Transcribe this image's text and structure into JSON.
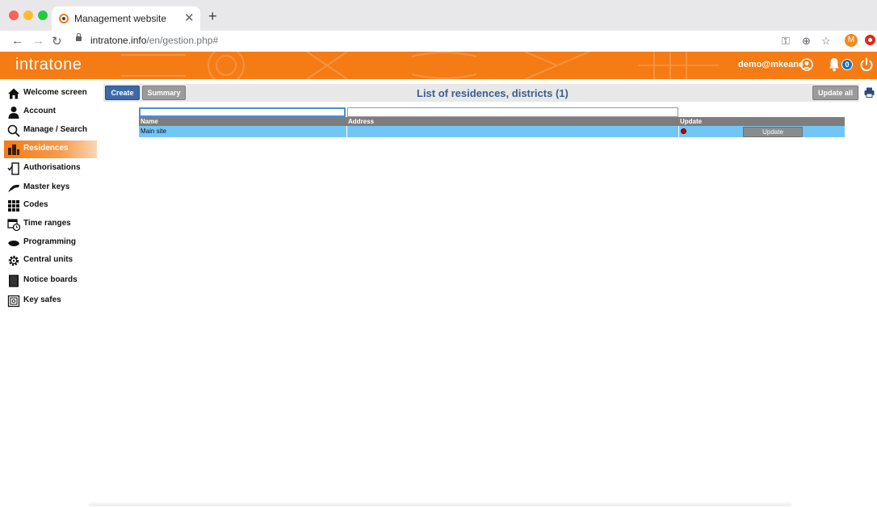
{
  "browser": {
    "tab_title": "Management website",
    "url_domain": "intratone.info",
    "url_path": "/en/gestion.php#",
    "profile_initial": "M"
  },
  "header": {
    "logo_text": "intratone",
    "user_email": "demo@mkeane",
    "notification_count": "0"
  },
  "sidebar": {
    "items": [
      {
        "label": "Welcome screen",
        "icon": "home-icon"
      },
      {
        "label": "Account",
        "icon": "person-icon"
      },
      {
        "label": "Manage / Search",
        "icon": "search-icon"
      },
      {
        "label": "Residences",
        "icon": "buildings-icon",
        "active": true
      },
      {
        "label": "Authorisations",
        "icon": "door-check-icon"
      },
      {
        "label": "Master keys",
        "icon": "key-fob-icon"
      },
      {
        "label": "Codes",
        "icon": "keypad-icon"
      },
      {
        "label": "Time ranges",
        "icon": "calendar-clock-icon"
      },
      {
        "label": "Programming",
        "icon": "programmer-icon"
      },
      {
        "label": "Central units",
        "icon": "gear-icon"
      },
      {
        "label": "Notice boards",
        "icon": "notice-board-icon"
      },
      {
        "label": "Key safes",
        "icon": "safe-icon"
      }
    ]
  },
  "toolbar": {
    "create_label": "Create",
    "summary_label": "Summary",
    "update_all_label": "Update all"
  },
  "page": {
    "title": "List of residences, districts (1)"
  },
  "table": {
    "filters": {
      "name_value": "",
      "address_value": ""
    },
    "columns": [
      "Name",
      "Address",
      "Update"
    ],
    "rows": [
      {
        "name": "Main site",
        "address": "",
        "update_button": "Update",
        "status_color": "#c00000"
      }
    ]
  },
  "colors": {
    "brand_orange": "#f57b14",
    "create_blue": "#3d6aa7",
    "title_blue": "#3a5f90",
    "row_blue": "#72c6f5"
  }
}
